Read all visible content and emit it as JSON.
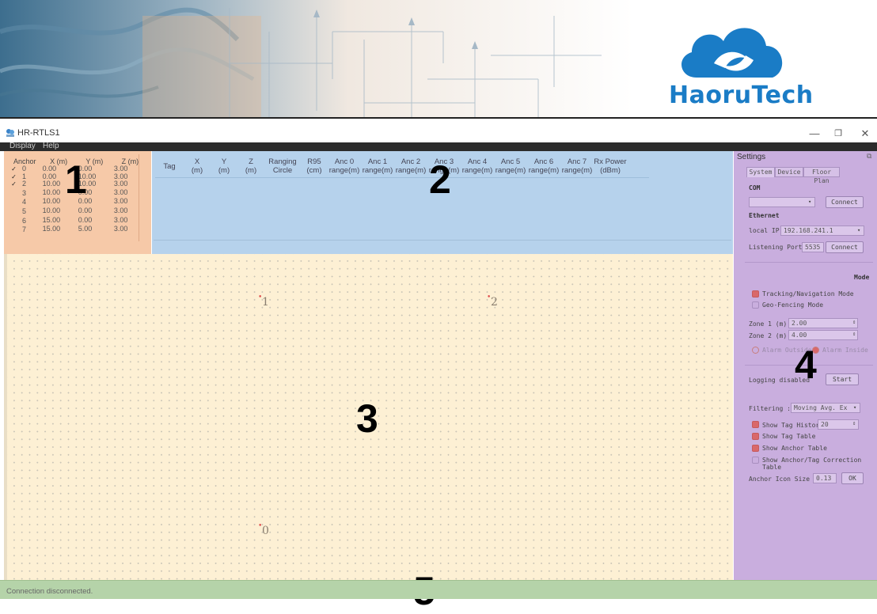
{
  "banner": {
    "logo_text": "HaoruTech",
    "brand_color": "#1a7cc6"
  },
  "window": {
    "title": "HR-RTLS1",
    "minimize": "—",
    "maximize": "❐",
    "close": "✕"
  },
  "menu": {
    "items": [
      "Display",
      "Help"
    ]
  },
  "anchor_table": {
    "headers": [
      "Anchor",
      "X (m)",
      "Y (m)",
      "Z (m)"
    ],
    "rows": [
      {
        "checked": true,
        "id": "0",
        "x": "0.00",
        "y": "0.00",
        "z": "3.00"
      },
      {
        "checked": true,
        "id": "1",
        "x": "0.00",
        "y": "10.00",
        "z": "3.00"
      },
      {
        "checked": true,
        "id": "2",
        "x": "10.00",
        "y": "10.00",
        "z": "3.00"
      },
      {
        "checked": false,
        "id": "3",
        "x": "10.00",
        "y": "0.00",
        "z": "3.00"
      },
      {
        "checked": false,
        "id": "4",
        "x": "10.00",
        "y": "0.00",
        "z": "3.00"
      },
      {
        "checked": false,
        "id": "5",
        "x": "10.00",
        "y": "0.00",
        "z": "3.00"
      },
      {
        "checked": false,
        "id": "6",
        "x": "15.00",
        "y": "0.00",
        "z": "3.00"
      },
      {
        "checked": false,
        "id": "7",
        "x": "15.00",
        "y": "5.00",
        "z": "3.00"
      }
    ]
  },
  "tag_table": {
    "headers": [
      [
        "Tag"
      ],
      [
        "X",
        "(m)"
      ],
      [
        "Y",
        "(m)"
      ],
      [
        "Z",
        "(m)"
      ],
      [
        "Ranging",
        "Circle"
      ],
      [
        "R95",
        "(cm)"
      ],
      [
        "Anc 0",
        "range(m)"
      ],
      [
        "Anc 1",
        "range(m)"
      ],
      [
        "Anc 2",
        "range(m)"
      ],
      [
        "Anc 3",
        "range(m)"
      ],
      [
        "Anc 4",
        "range(m)"
      ],
      [
        "Anc 5",
        "range(m)"
      ],
      [
        "Anc 6",
        "range(m)"
      ],
      [
        "Anc 7",
        "range(m)"
      ],
      [
        "Rx Power",
        "(dBm)"
      ]
    ]
  },
  "floor": {
    "anchors": [
      {
        "label": "1"
      },
      {
        "label": "2"
      },
      {
        "label": "0"
      }
    ]
  },
  "settings": {
    "title": "Settings",
    "tabs": [
      "System",
      "Device",
      "Floor Plan"
    ],
    "com_label": "COM",
    "com_value": "",
    "connect_label": "Connect",
    "ethernet_label": "Ethernet",
    "local_ip_label": "local IP",
    "local_ip_value": "192.168.241.1",
    "listening_port_label": "Listening Port",
    "listening_port_value": "5535",
    "mode_label": "Mode",
    "tracking_label": "Tracking/Navigation Mode",
    "geofencing_label": "Geo-Fencing Mode",
    "zone1_label": "Zone 1 (m)",
    "zone1_value": "2.00",
    "zone2_label": "Zone 2 (m)",
    "zone2_value": "4.00",
    "alarm_outside_label": "Alarm Outside",
    "alarm_inside_label": "Alarm Inside",
    "logging_label": "Logging disabled",
    "start_label": "Start",
    "filtering_label": "Filtering :",
    "filtering_value": "Moving Avg. Ex",
    "show_tag_history_label": "Show Tag History",
    "show_tag_history_value": "20",
    "show_tag_table_label": "Show Tag Table",
    "show_anchor_table_label": "Show Anchor Table",
    "show_correction_label": "Show Anchor/Tag Correction Table",
    "anchor_icon_size_label": "Anchor Icon Size",
    "anchor_icon_size_value": "0.13",
    "ok_label": "OK"
  },
  "region_labels": [
    "1",
    "2",
    "3",
    "4",
    "5"
  ],
  "status": {
    "text": "Connection disconnected."
  }
}
